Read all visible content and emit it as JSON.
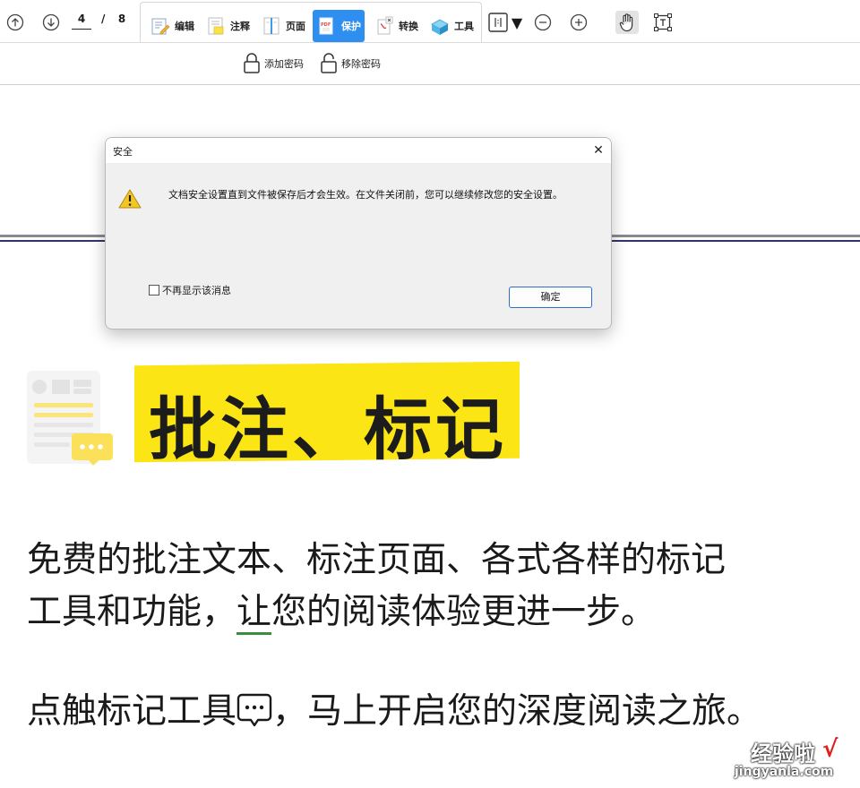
{
  "toolbar": {
    "page_current": "4",
    "page_separator": "/",
    "page_total": "8",
    "tools": [
      {
        "label": "编辑"
      },
      {
        "label": "注释"
      },
      {
        "label": "页面"
      },
      {
        "label": "保护"
      },
      {
        "label": "转换"
      },
      {
        "label": "工具"
      }
    ],
    "active_tool": "保护",
    "accent_color": "#2f8ff0",
    "dropdown_glyph": "▼"
  },
  "ribbon": {
    "add_password": "添加密码",
    "remove_password": "移除密码"
  },
  "dialog": {
    "title": "安全",
    "close_glyph": "✕",
    "message": "文档安全设置直到文件被保存后才会生效。在文件关闭前，您可以继续修改您的安全设置。",
    "checkbox_label": "不再显示该消息",
    "checkbox_checked": false,
    "ok_label": "确定"
  },
  "document": {
    "heading": "批注、标记",
    "heading_highlight_color": "#fbe515",
    "para1_line1": "免费的批注文本、标注页面、各式各样的标记",
    "para1_line2_pre": "工具和功能，",
    "para1_line2_ul": "让",
    "para1_line2_post": "您的阅读体验更进一步。",
    "para2_pre": "点触标记工具",
    "para2_post": "，马上开启您的深度阅读之旅。"
  },
  "watermark": {
    "text": "经验啦",
    "check": "√",
    "url": "jingyanla.com"
  }
}
